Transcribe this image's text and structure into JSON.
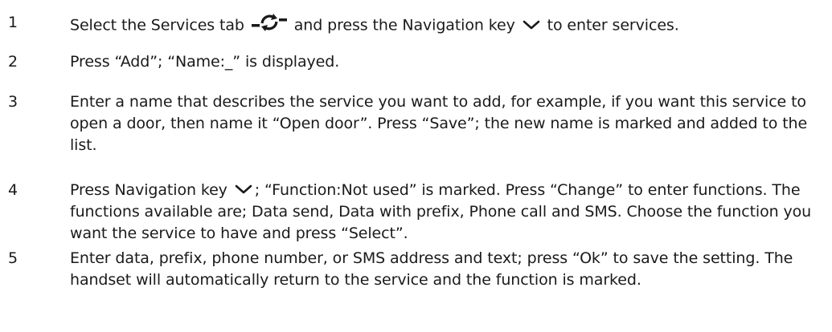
{
  "steps": [
    {
      "number": "1",
      "segments": [
        {
          "type": "text",
          "value": "Select the Services tab "
        },
        {
          "type": "icon",
          "icon": "services-tab-icon"
        },
        {
          "type": "text",
          "value": " and press the Navigation key "
        },
        {
          "type": "icon",
          "icon": "navigation-down-key-icon"
        },
        {
          "type": "text",
          "value": " to enter services."
        }
      ]
    },
    {
      "number": "2",
      "segments": [
        {
          "type": "text",
          "value": "Press “Add”; “Name:_” is displayed."
        }
      ]
    },
    {
      "number": "3",
      "segments": [
        {
          "type": "text",
          "value": "Enter a name that describes the service you want to add, for example, if you want this service to open a door, then name it “Open door”. Press “Save”; the new name is marked and added to the list."
        }
      ]
    },
    {
      "number": "4",
      "segments": [
        {
          "type": "text",
          "value": "Press Navigation key "
        },
        {
          "type": "icon",
          "icon": "navigation-down-key-icon"
        },
        {
          "type": "text",
          "value": "; “Function:Not used” is marked. Press “Change” to enter functions. The functions available are; Data send, Data with prefix, Phone call and SMS. Choose the function you want the service to have and press “Select”."
        }
      ]
    },
    {
      "number": "5",
      "segments": [
        {
          "type": "text",
          "value": "Enter data, prefix, phone number, or SMS address and text; press “Ok” to save the setting. The handset will automatically return to the service and the function is marked."
        }
      ]
    }
  ]
}
